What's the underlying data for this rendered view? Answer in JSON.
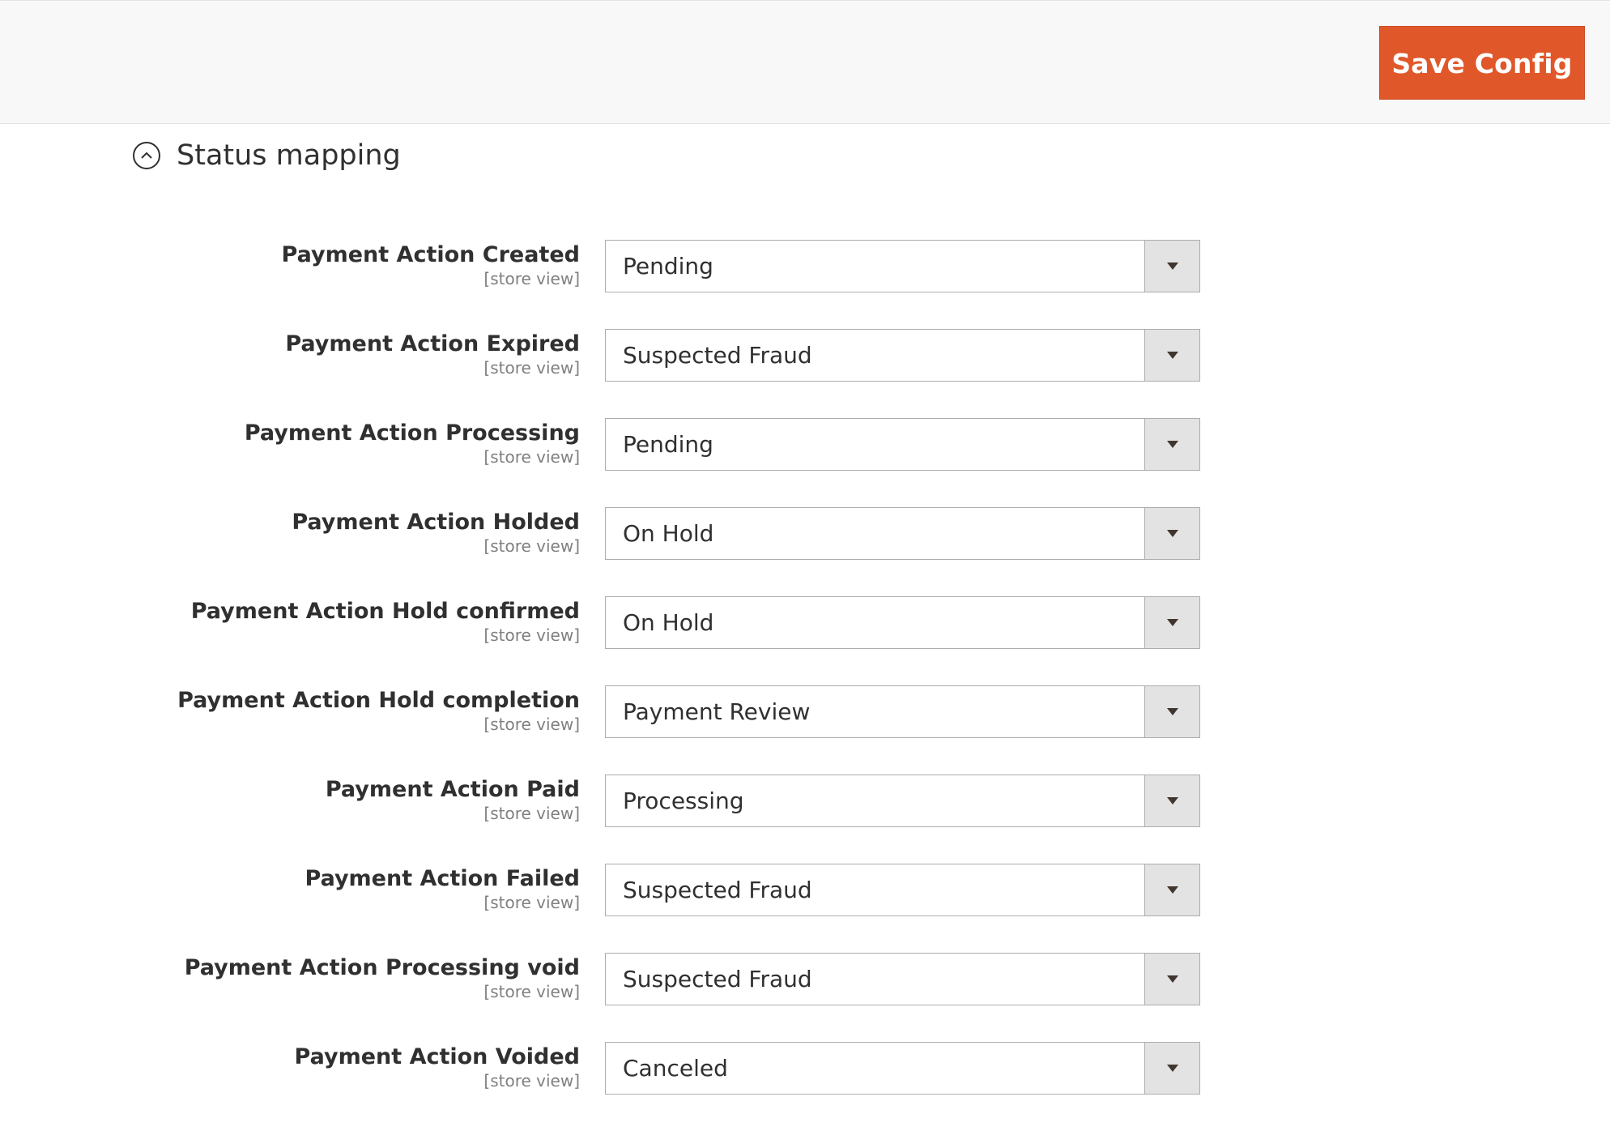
{
  "header": {
    "save_label": "Save Config"
  },
  "section": {
    "title": "Status mapping",
    "collapse_icon": "chevron-up-circle-icon"
  },
  "fields": [
    {
      "label": "Payment Action Created",
      "scope": "[store view]",
      "value": "Pending"
    },
    {
      "label": "Payment Action Expired",
      "scope": "[store view]",
      "value": "Suspected Fraud"
    },
    {
      "label": "Payment Action Processing",
      "scope": "[store view]",
      "value": "Pending"
    },
    {
      "label": "Payment Action Holded",
      "scope": "[store view]",
      "value": "On Hold"
    },
    {
      "label": "Payment Action Hold confirmed",
      "scope": "[store view]",
      "value": "On Hold"
    },
    {
      "label": "Payment Action Hold completion",
      "scope": "[store view]",
      "value": "Payment Review"
    },
    {
      "label": "Payment Action Paid",
      "scope": "[store view]",
      "value": "Processing"
    },
    {
      "label": "Payment Action Failed",
      "scope": "[store view]",
      "value": "Suspected Fraud"
    },
    {
      "label": "Payment Action Processing void",
      "scope": "[store view]",
      "value": "Suspected Fraud"
    },
    {
      "label": "Payment Action Voided",
      "scope": "[store view]",
      "value": "Canceled"
    }
  ],
  "colors": {
    "primary_button": "#e0582a",
    "header_bg": "#f8f8f8",
    "select_arrow_bg": "#e3e3e3"
  }
}
